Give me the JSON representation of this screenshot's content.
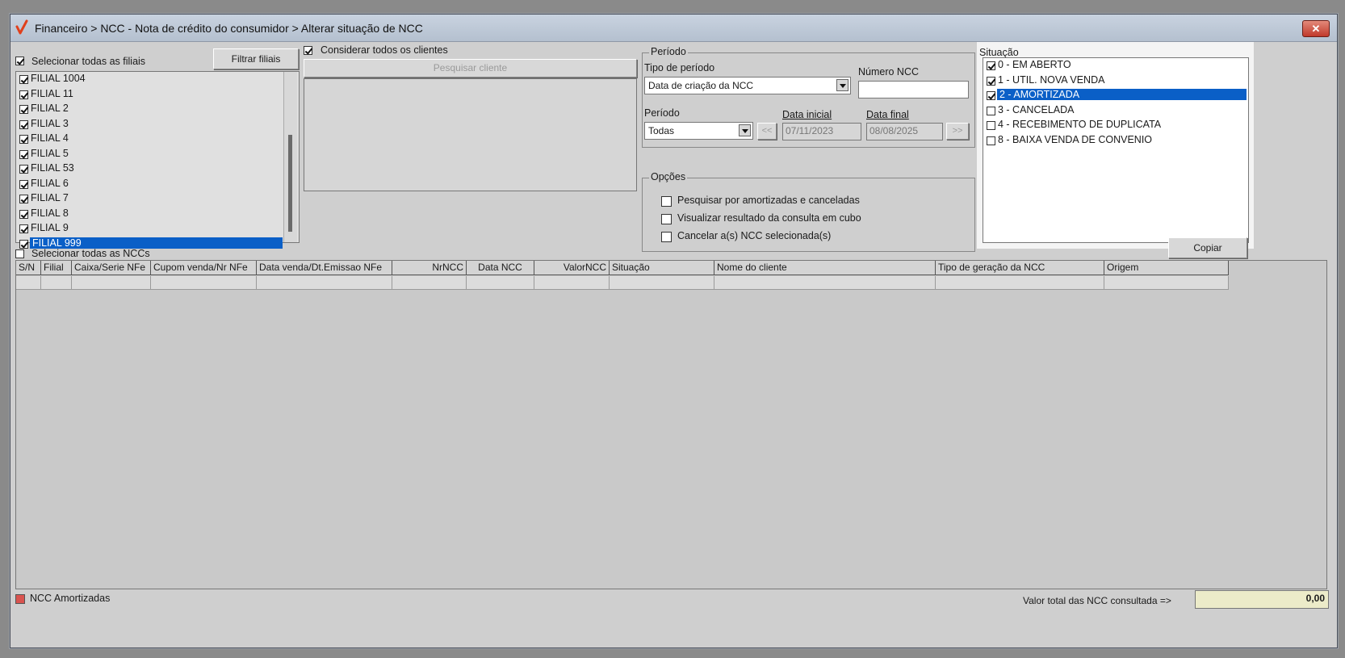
{
  "window": {
    "title": "Financeiro > NCC - Nota de crédito do consumidor > Alterar situação de NCC",
    "close_label": "✕"
  },
  "filiais": {
    "select_all_label": "Selecionar todas as filiais",
    "select_all_checked": true,
    "filter_button": "Filtrar filiais",
    "items": [
      {
        "label": "FILIAL 1004",
        "checked": true
      },
      {
        "label": "FILIAL 11",
        "checked": true
      },
      {
        "label": "FILIAL 2",
        "checked": true
      },
      {
        "label": "FILIAL 3",
        "checked": true
      },
      {
        "label": "FILIAL 4",
        "checked": true
      },
      {
        "label": "FILIAL 5",
        "checked": true
      },
      {
        "label": "FILIAL 53",
        "checked": true
      },
      {
        "label": "FILIAL 6",
        "checked": true
      },
      {
        "label": "FILIAL 7",
        "checked": true
      },
      {
        "label": "FILIAL 8",
        "checked": true
      },
      {
        "label": "FILIAL 9",
        "checked": true
      },
      {
        "label": "FILIAL 999",
        "checked": true,
        "selected": true
      }
    ]
  },
  "clientes": {
    "consider_all_label": "Considerar todos os clientes",
    "consider_all_checked": true,
    "search_button": "Pesquisar cliente"
  },
  "periodo": {
    "group_title": "Período",
    "tipo_label": "Tipo de período",
    "tipo_value": "Data de criação da NCC",
    "numero_label": "Número NCC",
    "numero_value": "",
    "periodo_label": "Período",
    "periodo_value": "Todas",
    "prev_button": "<<",
    "next_button": ">>",
    "data_inicial_label": "Data inicial",
    "data_inicial_value": "07/11/2023",
    "data_final_label": "Data final",
    "data_final_value": "08/08/2025"
  },
  "opcoes": {
    "group_title": "Opções",
    "items": [
      {
        "label": "Pesquisar por amortizadas e canceladas",
        "checked": false
      },
      {
        "label": "Visualizar resultado da consulta em cubo",
        "checked": false
      },
      {
        "label": "Cancelar a(s) NCC selecionada(s)",
        "checked": false
      }
    ]
  },
  "situacao": {
    "label": "Situação",
    "items": [
      {
        "label": "0 - EM ABERTO",
        "checked": true
      },
      {
        "label": "1 - UTIL. NOVA VENDA",
        "checked": true
      },
      {
        "label": "2 - AMORTIZADA",
        "checked": true,
        "selected": true
      },
      {
        "label": "3 - CANCELADA",
        "checked": false
      },
      {
        "label": "4 - RECEBIMENTO DE DUPLICATA",
        "checked": false
      },
      {
        "label": "8 - BAIXA VENDA DE CONVENIO",
        "checked": false
      }
    ]
  },
  "copy_button": "Copiar",
  "select_all_ncc_label": "Selecionar todas as NCCs",
  "select_all_ncc_checked": false,
  "table": {
    "columns": [
      "S/N",
      "Filial",
      "Caixa/Serie NFe",
      "Cupom venda/Nr NFe",
      "Data venda/Dt.Emissao NFe",
      "NrNCC",
      "Data NCC",
      "ValorNCC",
      "Situação",
      "Nome do cliente",
      "Tipo de geração da NCC",
      "Origem"
    ]
  },
  "footer": {
    "legend_label": "NCC Amortizadas",
    "legend_color": "#d9534f",
    "total_label": "Valor total das NCC consultada =>",
    "total_value": "0,00"
  }
}
